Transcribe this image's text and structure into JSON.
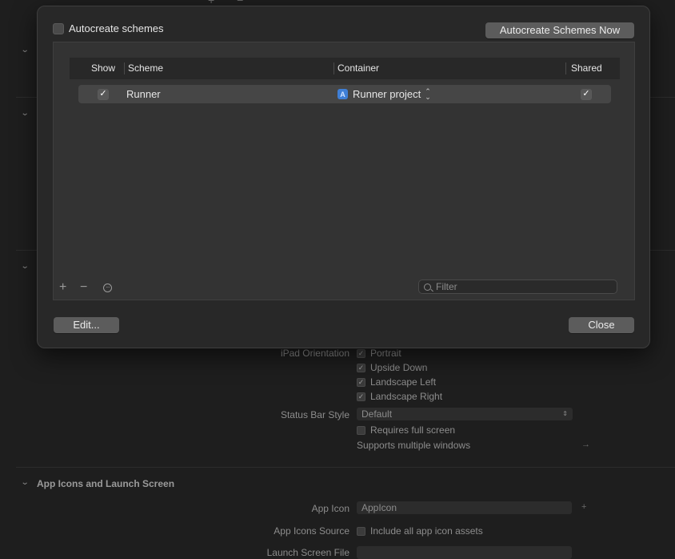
{
  "background": {
    "ipad_orientation": {
      "label": "iPad Orientation",
      "options": [
        {
          "label": "Portrait",
          "checked": true
        },
        {
          "label": "Upside Down",
          "checked": true
        },
        {
          "label": "Landscape Left",
          "checked": true
        },
        {
          "label": "Landscape Right",
          "checked": true
        }
      ]
    },
    "status_bar": {
      "label": "Status Bar Style",
      "value": "Default"
    },
    "requires_full_screen": {
      "label": "Requires full screen",
      "checked": false
    },
    "supports_multiple_windows": {
      "label": "Supports multiple windows"
    },
    "app_icons_section": {
      "title": "App Icons and Launch Screen"
    },
    "app_icon": {
      "label": "App Icon",
      "value": "AppIcon"
    },
    "app_icons_source": {
      "label": "App Icons Source",
      "option": "Include all app icon assets",
      "checked": false
    },
    "launch_screen_file": {
      "label": "Launch Screen File"
    }
  },
  "sheet": {
    "autocreate_checkbox": {
      "label": "Autocreate schemes",
      "checked": false
    },
    "autocreate_now_button": "Autocreate Schemes Now",
    "table": {
      "columns": [
        "Show",
        "Scheme",
        "Container",
        "Shared"
      ],
      "rows": [
        {
          "show": true,
          "scheme": "Runner",
          "container": "Runner project",
          "shared": true
        }
      ]
    },
    "filter": {
      "placeholder": "Filter"
    },
    "edit_button": "Edit...",
    "close_button": "Close"
  },
  "icons": {
    "add": "plus-icon",
    "remove": "minus-icon",
    "more": "ellipsis-circle-icon",
    "search": "search-icon",
    "container": "xcode-project-icon"
  },
  "colors": {
    "sheet_bg": "#282828",
    "panel_bg": "#333333",
    "button_bg": "#5c5c5c",
    "row_selected": "#464646",
    "project_icon": "#3f7fd6"
  }
}
